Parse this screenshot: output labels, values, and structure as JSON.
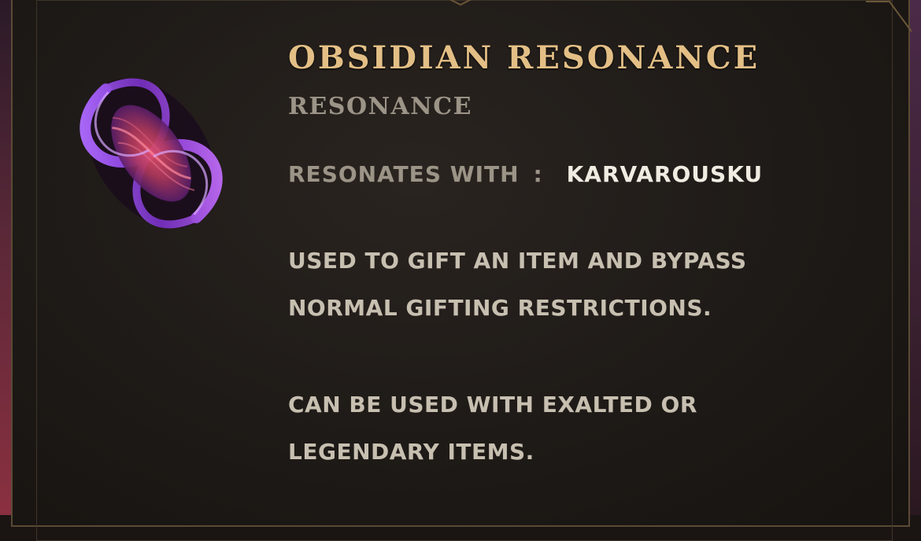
{
  "item": {
    "name": "OBSIDIAN RESONANCE",
    "type": "RESONANCE",
    "resonates_label": "RESONATES WITH",
    "resonates_separator": ":",
    "resonates_value": "KARVAROUSKU",
    "description_1": "USED TO GIFT AN ITEM AND BYPASS NORMAL GIFTING RESTRICTIONS.",
    "description_2": "CAN BE USED WITH EXALTED OR LEGENDARY ITEMS.",
    "icon": "obsidian-resonance-swirl-icon"
  },
  "colors": {
    "title": "#e3bf86",
    "muted": "#9b9487",
    "highlight": "#f0ece2",
    "body": "#c7bfb0",
    "icon_purple": "#8b3fd6",
    "icon_red": "#c8405a"
  }
}
